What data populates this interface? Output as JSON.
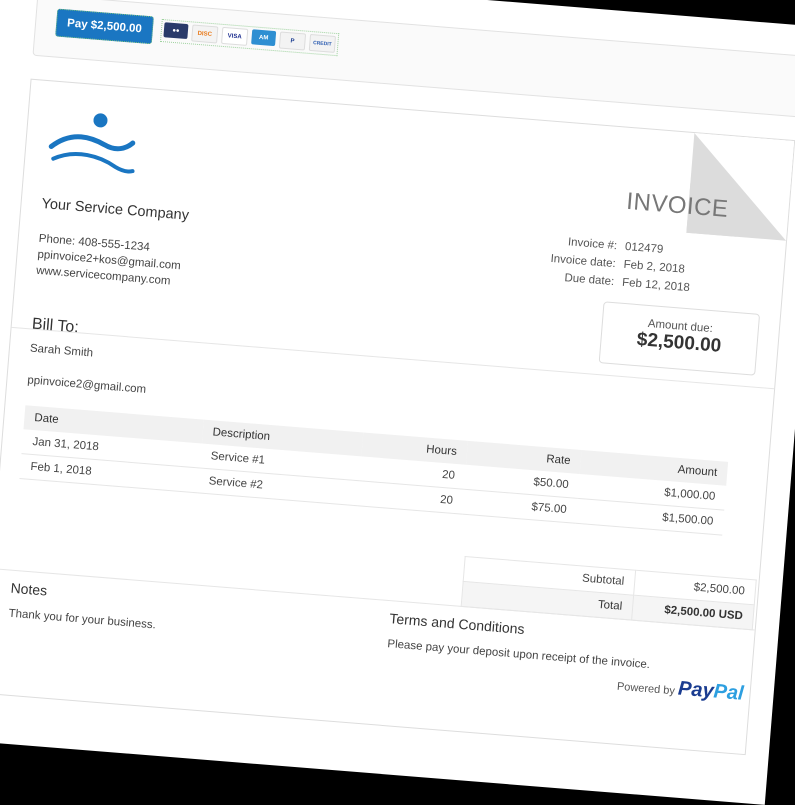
{
  "pay_bar": {
    "pay_button": "Pay $2,500.00",
    "cards": [
      "MasterCard",
      "Discover",
      "VISA",
      "Amex",
      "PayPal",
      "Credit"
    ]
  },
  "company": {
    "name": "Your Service Company",
    "phone": "Phone: 408-555-1234",
    "email": "ppinvoice2+kos@gmail.com",
    "website": "www.servicecompany.com"
  },
  "invoice": {
    "title": "INVOICE",
    "number_label": "Invoice #:",
    "number": "012479",
    "date_label": "Invoice date:",
    "date": "Feb 2, 2018",
    "due_label": "Due date:",
    "due": "Feb 12, 2018",
    "amount_due_label": "Amount due:",
    "amount_due": "$2,500.00"
  },
  "bill_to": {
    "heading": "Bill To:",
    "name": "Sarah Smith",
    "email": "ppinvoice2@gmail.com"
  },
  "items": {
    "headers": {
      "date": "Date",
      "description": "Description",
      "hours": "Hours",
      "rate": "Rate",
      "amount": "Amount"
    },
    "rows": [
      {
        "date": "Jan 31, 2018",
        "description": "Service #1",
        "hours": "20",
        "rate": "$50.00",
        "amount": "$1,000.00"
      },
      {
        "date": "Feb 1, 2018",
        "description": "Service #2",
        "hours": "20",
        "rate": "$75.00",
        "amount": "$1,500.00"
      }
    ]
  },
  "totals": {
    "subtotal_label": "Subtotal",
    "subtotal": "$2,500.00",
    "total_label": "Total",
    "total": "$2,500.00 USD"
  },
  "notes": {
    "heading": "Notes",
    "text": "Thank you for your business."
  },
  "terms": {
    "heading": "Terms and Conditions",
    "text": "Please pay your deposit upon receipt of the invoice."
  },
  "footer": {
    "powered_by": "Powered by",
    "brand_a": "Pay",
    "brand_b": "Pal"
  }
}
